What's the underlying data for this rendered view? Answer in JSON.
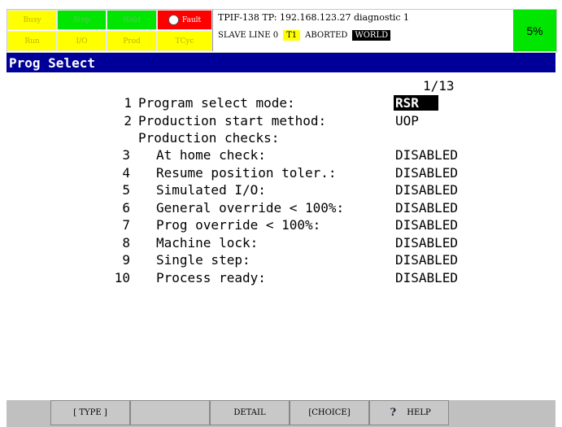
{
  "status": {
    "leds_top": [
      {
        "label": "Busy",
        "color": "y"
      },
      {
        "label": "Step",
        "color": "g"
      },
      {
        "label": "Hold",
        "color": "g"
      },
      {
        "label": "Fault",
        "color": "r"
      }
    ],
    "leds_bottom": [
      {
        "label": "Run",
        "color": "y"
      },
      {
        "label": "I/O",
        "color": "y"
      },
      {
        "label": "Prod",
        "color": "y"
      },
      {
        "label": "TCyc",
        "color": "y"
      }
    ],
    "message_line1": "TPIF-138 TP: 192.168.123.27 diagnostic 1",
    "line2_prefix": "SLAVE LINE 0",
    "mode": "T1",
    "state": "ABORTED",
    "frame": "WORLD",
    "override": "5%"
  },
  "title": "Prog Select",
  "page": "1/13",
  "items": [
    {
      "num": "1",
      "label": "Program select mode:",
      "value": "RSR",
      "selected": true
    },
    {
      "num": "2",
      "label": "Production start method:",
      "value": "UOP",
      "selected": false
    },
    {
      "num": "",
      "label": "Production checks:",
      "value": "",
      "selected": false
    },
    {
      "num": "3",
      "label": "At home check:",
      "value": "DISABLED",
      "selected": false
    },
    {
      "num": "4",
      "label": "Resume position toler.:",
      "value": "DISABLED",
      "selected": false
    },
    {
      "num": "5",
      "label": "Simulated I/O:",
      "value": "DISABLED",
      "selected": false
    },
    {
      "num": "6",
      "label": "General override < 100%:",
      "value": "DISABLED",
      "selected": false
    },
    {
      "num": "7",
      "label": "Prog override < 100%:",
      "value": "DISABLED",
      "selected": false
    },
    {
      "num": "8",
      "label": "Machine lock:",
      "value": "DISABLED",
      "selected": false
    },
    {
      "num": "9",
      "label": "Single step:",
      "value": "DISABLED",
      "selected": false
    },
    {
      "num": "10",
      "label": "Process ready:",
      "value": "DISABLED",
      "selected": false
    }
  ],
  "fkeys": {
    "f1": "[ TYPE ]",
    "f2": "",
    "f3": "DETAIL",
    "f4": "[CHOICE]",
    "f5": "HELP"
  },
  "colors": {
    "title_bg": "#000099",
    "yellow": "#ffff00",
    "green": "#00e600",
    "red": "#ff0000"
  }
}
